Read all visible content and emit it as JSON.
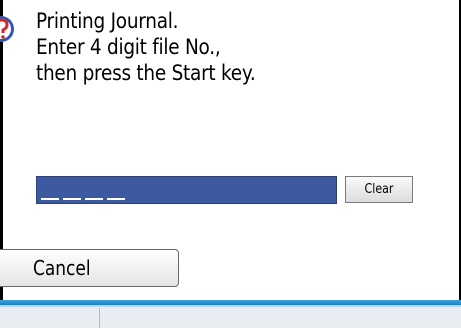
{
  "dialog": {
    "message_lines": [
      "Printing Journal.",
      "Enter 4 digit file No.,",
      "then press the Start key."
    ],
    "icon": "question-icon"
  },
  "file_number_input": {
    "value": "",
    "digit_count": 4
  },
  "buttons": {
    "clear_label": "Clear",
    "cancel_label": "Cancel"
  },
  "colors": {
    "input_fill": "#3d5aa0",
    "status_bar": "#1f7fc2",
    "icon_red": "#d62a2a",
    "icon_blue": "#2f57b8"
  }
}
